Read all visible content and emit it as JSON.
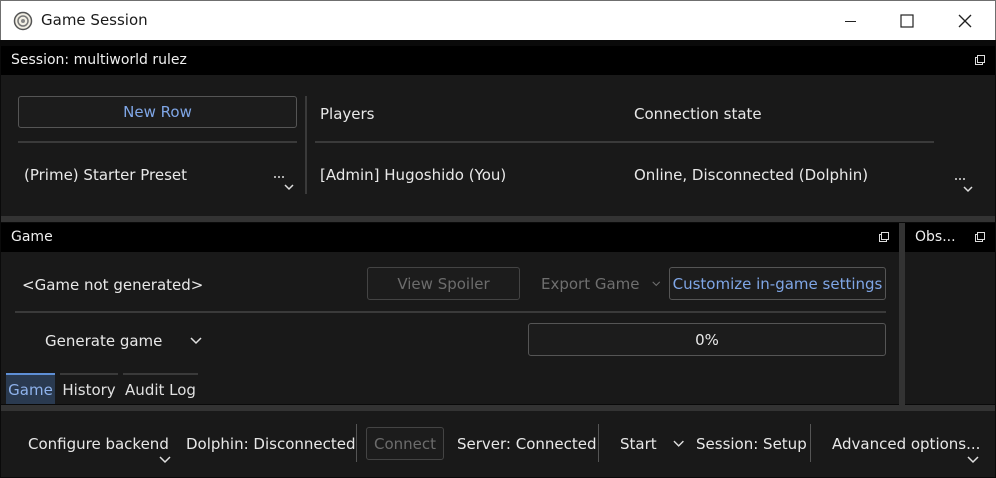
{
  "window": {
    "title": "Game Session"
  },
  "session_panel": {
    "header": "Session: multiworld rulez",
    "new_row_button": "New Row",
    "preset_name": "(Prime) Starter Preset",
    "players_header": "Players",
    "connection_header": "Connection state",
    "player_name": "[Admin] Hugoshido (You)",
    "player_connection": "Online, Disconnected (Dolphin)"
  },
  "game_panel": {
    "header": "Game",
    "status": "<Game not generated>",
    "view_spoiler": "View Spoiler",
    "export_game": "Export Game",
    "customize": "Customize in-game settings",
    "generate_game": "Generate game",
    "progress_text": "0%",
    "progress_value": 0,
    "tabs": [
      "Game",
      "History",
      "Audit Log"
    ],
    "active_tab": "Game"
  },
  "observer_panel": {
    "header": "Obs..."
  },
  "bottom_bar": {
    "configure_backend": "Configure backend",
    "dolphin_status": "Dolphin: Disconnected",
    "connect": "Connect",
    "server_status": "Server: Connected",
    "start": "Start",
    "session_status": "Session: Setup",
    "advanced_options": "Advanced options..."
  },
  "colors": {
    "accent": "#7fa6e6",
    "active_tab_bg": "#2a3a50",
    "panel_bg": "#191919",
    "header_bg": "#000000"
  }
}
